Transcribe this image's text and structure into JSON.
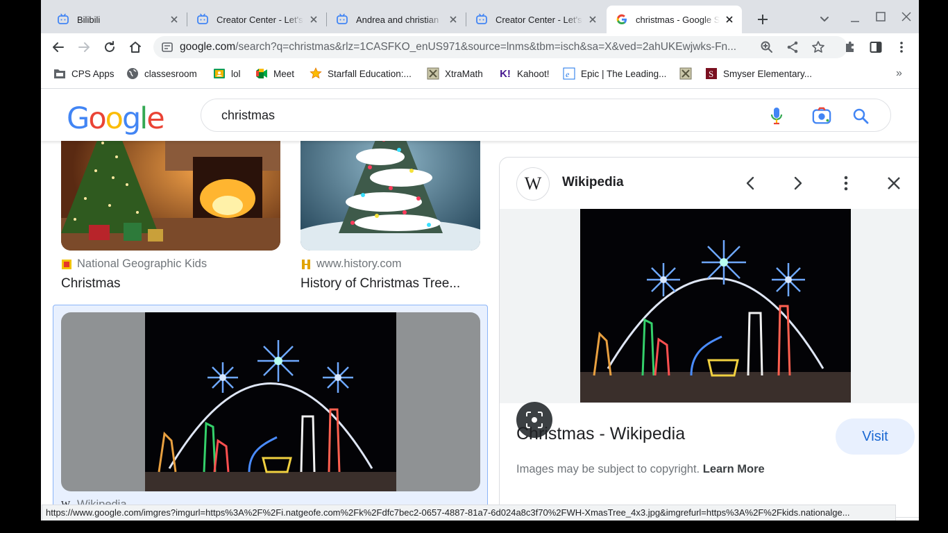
{
  "tabs": [
    {
      "title": "Bilibili",
      "active": false,
      "icon": "bilibili-icon"
    },
    {
      "title": "Creator Center - Let's",
      "active": false,
      "icon": "bilibili-icon"
    },
    {
      "title": "Andrea and christian",
      "active": false,
      "icon": "bilibili-icon"
    },
    {
      "title": "Creator Center - Let's",
      "active": false,
      "icon": "bilibili-icon"
    },
    {
      "title": "christmas - Google S",
      "active": true,
      "icon": "google-icon"
    }
  ],
  "address_bar": {
    "host": "google.com",
    "path": "/search?q=christmas&rlz=1CASFKO_enUS971&source=lnms&tbm=isch&sa=X&ved=2ahUKEwjwks-Fn..."
  },
  "bookmarks": [
    {
      "label": "CPS Apps",
      "icon": "folder-icon"
    },
    {
      "label": "classesroom",
      "icon": "globe-icon"
    },
    {
      "label": "lol",
      "icon": "classroom-icon"
    },
    {
      "label": "Meet",
      "icon": "meet-icon"
    },
    {
      "label": "Starfall Education:...",
      "icon": "star-icon"
    },
    {
      "label": "XtraMath",
      "icon": "xtramath-icon"
    },
    {
      "label": "Kahoot!",
      "icon": "kahoot-icon"
    },
    {
      "label": "Epic | The Leading...",
      "icon": "epic-icon"
    },
    {
      "label": "",
      "icon": "xtramath-icon"
    },
    {
      "label": "Smyser Elementary...",
      "icon": "smyser-icon"
    }
  ],
  "bookmarks_overflow": "»",
  "google": {
    "logo_letters": [
      "G",
      "o",
      "o",
      "g",
      "l",
      "e"
    ],
    "logo_colors": [
      "#4285f4",
      "#ea4335",
      "#fbbc05",
      "#4285f4",
      "#34a853",
      "#ea4335"
    ],
    "query": "christmas"
  },
  "results": [
    {
      "source": "National Geographic Kids",
      "title": "Christmas"
    },
    {
      "source": "www.history.com",
      "title": "History of Christmas Tree..."
    },
    {
      "source": "Wikipedia",
      "title": ""
    }
  ],
  "panel": {
    "source": "Wikipedia",
    "logo_letter": "W",
    "title": "Christmas - Wikipedia",
    "visit_label": "Visit",
    "copyright_text": "Images may be subject to copyright.",
    "learn_more": "Learn More"
  },
  "status_url": "https://www.google.com/imgres?imgurl=https%3A%2F%2Fi.natgeofe.com%2Fk%2Fdfc7bec2-0657-4887-81a7-6d024a8c3f70%2FWH-XmasTree_4x3.jpg&imgrefurl=https%3A%2F%2Fkids.nationalge...",
  "colors": {
    "accent": "#1a73e8",
    "visit_bg": "#e8f0fe",
    "tabstrip": "#dee1e6"
  }
}
